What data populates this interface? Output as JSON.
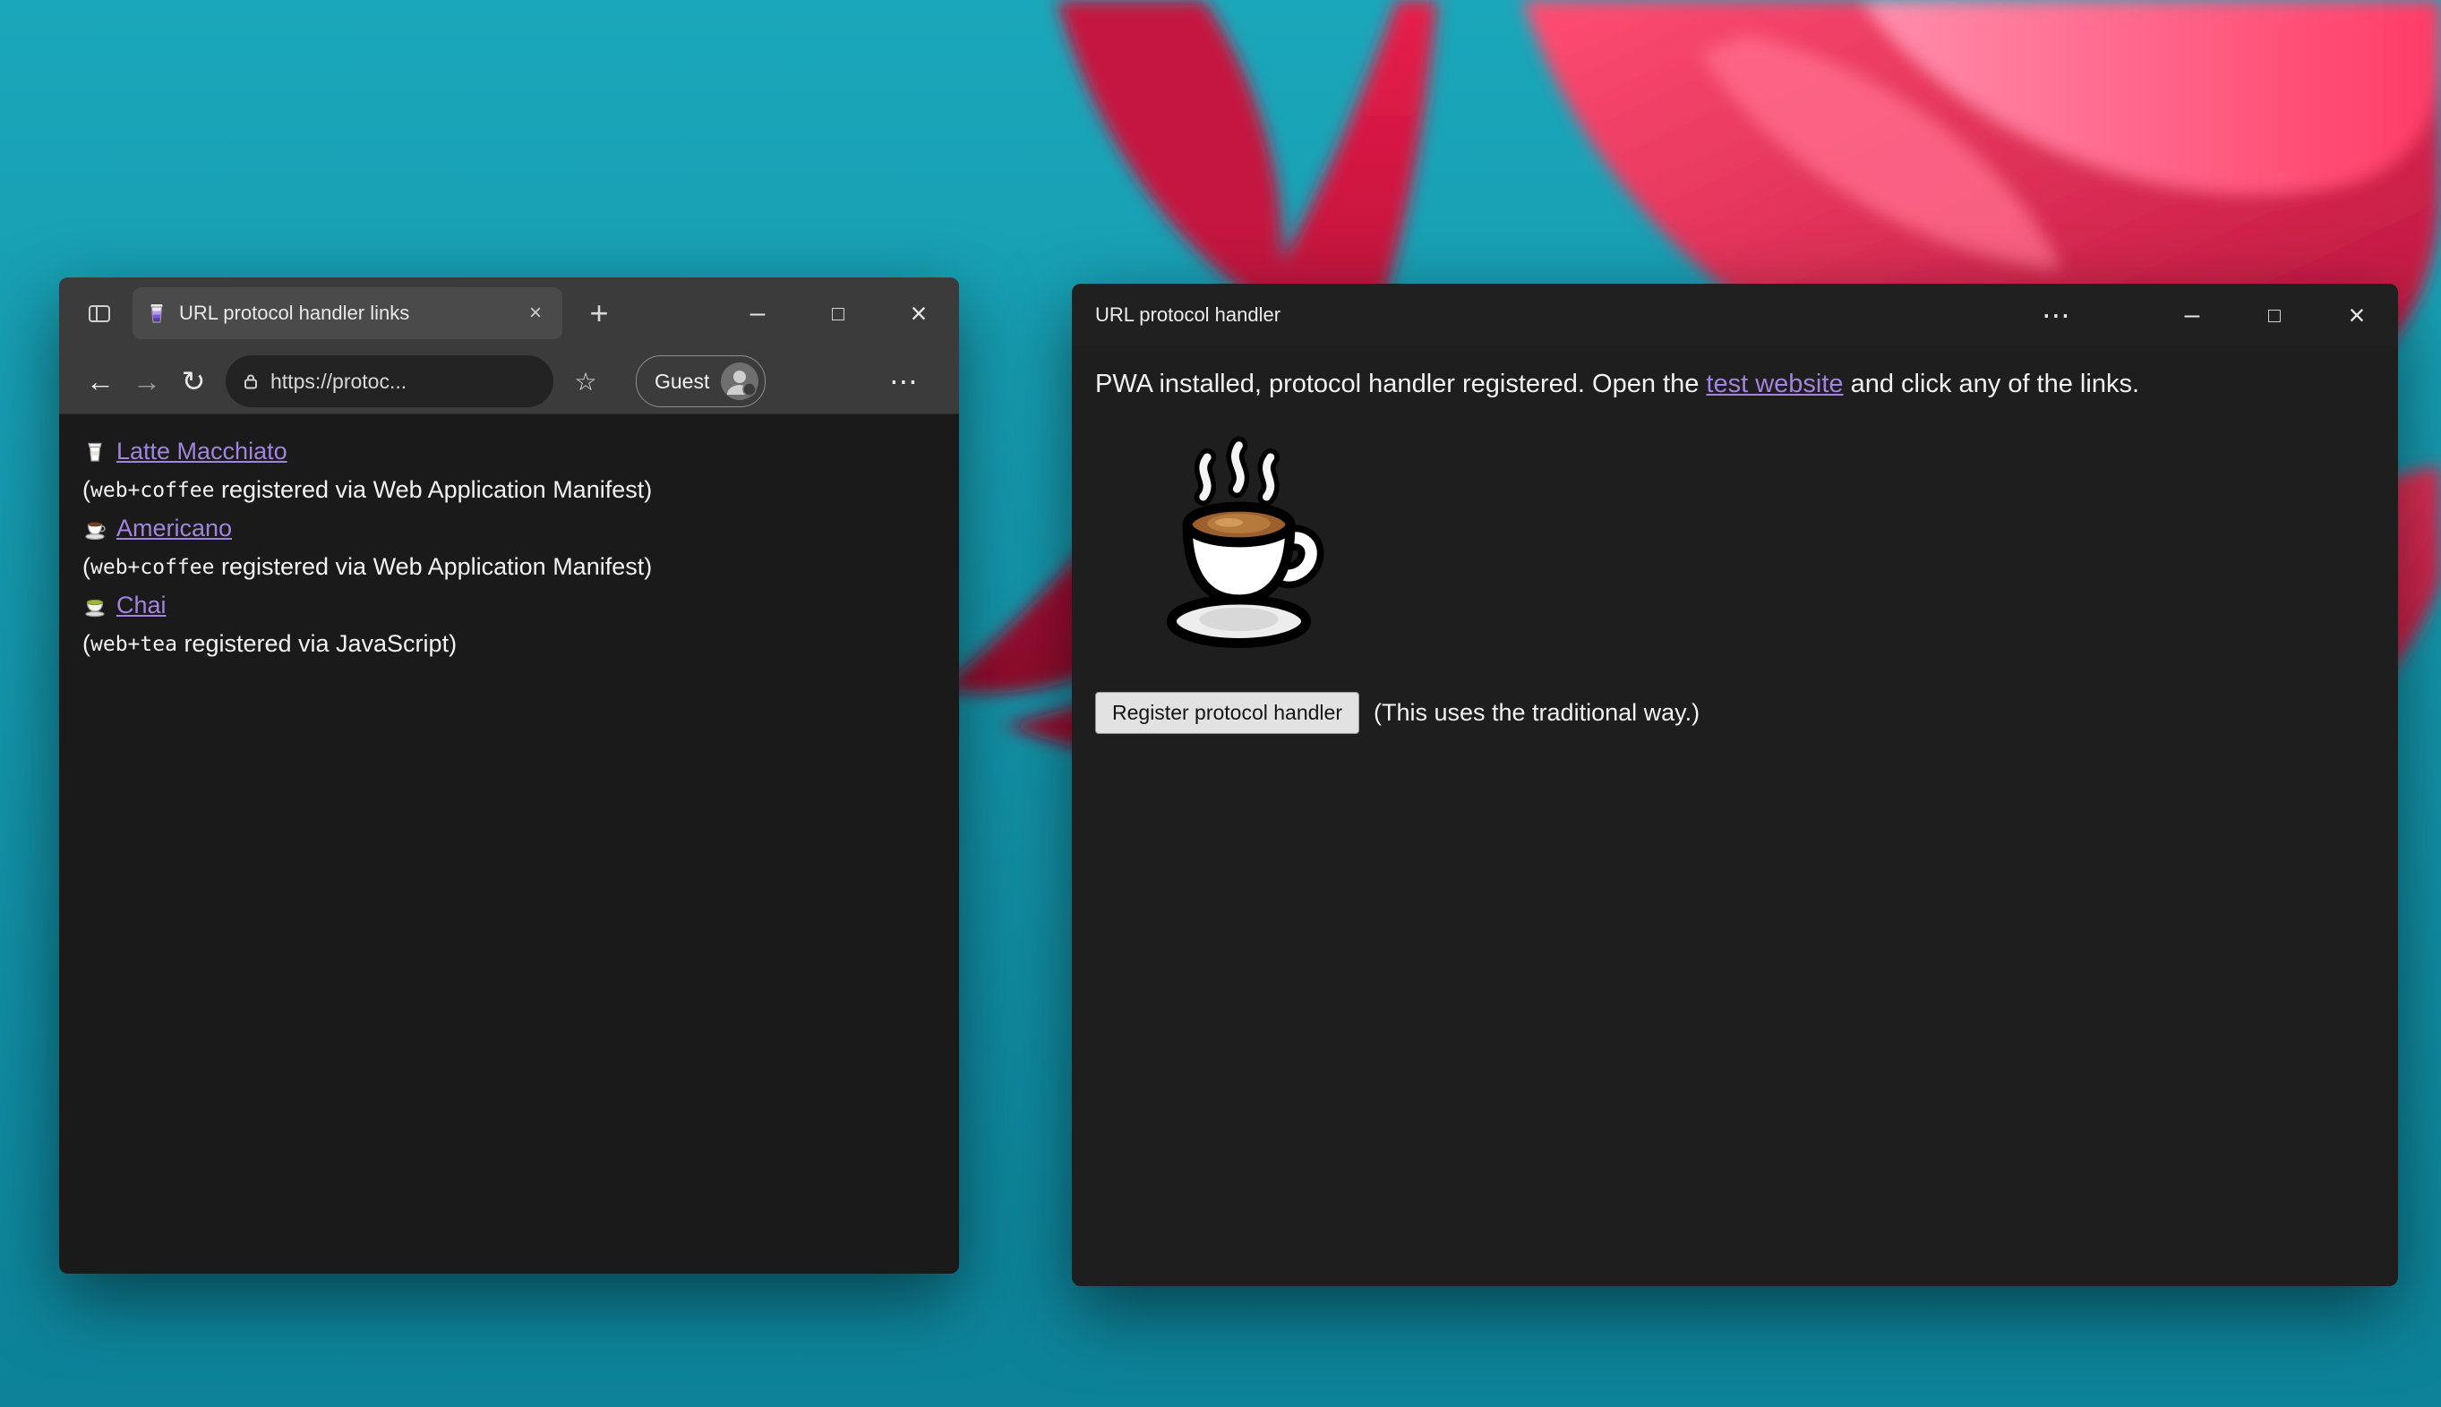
{
  "icons": {
    "back": "←",
    "forward": "→",
    "refresh": "↻",
    "new_tab": "+",
    "tab_close": "×",
    "minimize": "–",
    "maximize": "□",
    "close": "×",
    "more": "⋯",
    "favorites": "☆"
  },
  "browser": {
    "tab_title": "URL protocol handler links",
    "address_url": "https://protoc...",
    "profile_label": "Guest",
    "page": {
      "items": [
        {
          "label": "Latte Macchiato",
          "note_open": "(",
          "note_code": "web+coffee",
          "note_rest": " registered via Web Application Manifest)"
        },
        {
          "label": "Americano",
          "note_open": "(",
          "note_code": "web+coffee",
          "note_rest": " registered via Web Application Manifest)"
        },
        {
          "label": "Chai",
          "note_open": "(",
          "note_code": "web+tea",
          "note_rest": " registered via JavaScript)"
        }
      ]
    }
  },
  "pwa": {
    "title": "URL protocol handler",
    "intro_before": "PWA installed, protocol handler registered. Open the ",
    "intro_link": "test website",
    "intro_after": " and click any of the links.",
    "button_label": "Register protocol handler",
    "button_note": "(This uses the traditional way.)"
  },
  "colors": {
    "link": "#a184dd",
    "wallpaper_teal": "#17a3b8",
    "flower_red": "#e8274b"
  }
}
